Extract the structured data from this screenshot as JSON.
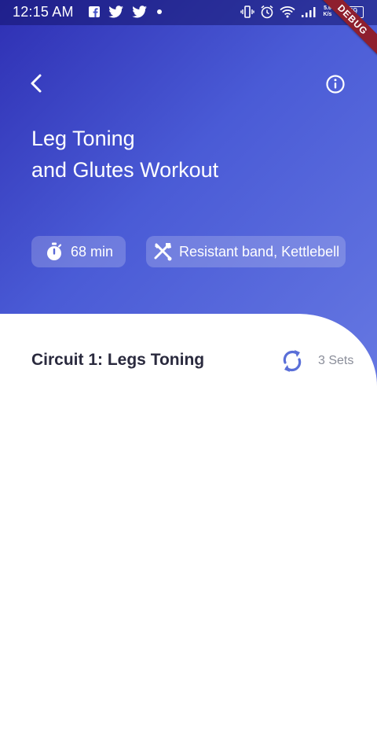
{
  "status_bar": {
    "time": "12:15 AM",
    "net_speed": "5.6 K/s",
    "battery": "29",
    "debug_label": "DEBUG"
  },
  "header": {
    "back_icon": "chevron-left-icon",
    "info_icon": "info-circle-icon",
    "title_line1": "Leg Toning",
    "title_line2": "and Glutes Workout"
  },
  "chips": {
    "duration": "68 min",
    "equipment": "Resistant band, Kettlebell"
  },
  "circuit": {
    "title": "Circuit 1: Legs Toning",
    "sets": "3 Sets"
  },
  "colors": {
    "gradient_start": "#2e2fb3",
    "gradient_end": "#6678e2",
    "accent": "#5a6fd8",
    "title_dark": "#2a2a3e",
    "muted": "#8a8d99"
  }
}
